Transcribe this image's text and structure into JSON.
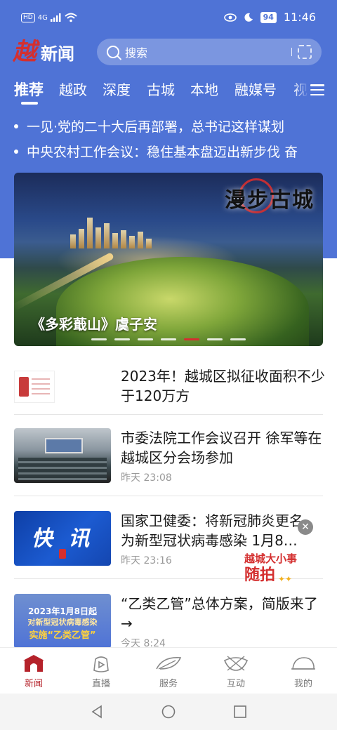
{
  "status_bar": {
    "left": [
      "HD",
      "4G"
    ],
    "battery": "94",
    "time": "11:46"
  },
  "header": {
    "logo": "越",
    "app_name": "新闻",
    "search_placeholder": "搜索"
  },
  "tabs": [
    {
      "label": "推荐",
      "active": true
    },
    {
      "label": "越政"
    },
    {
      "label": "深度"
    },
    {
      "label": "古城"
    },
    {
      "label": "本地"
    },
    {
      "label": "融媒号"
    },
    {
      "label": "视"
    }
  ],
  "ticker": [
    "一见·党的二十大后再部署，总书记这样谋划",
    "中央农村工作会议：稳住基本盘迈出新步伐 奋"
  ],
  "banner": {
    "brand_text": "漫步古城",
    "caption": "《多彩蕺山》虞子安",
    "slide_count": 7,
    "active_slide": 5
  },
  "news": [
    {
      "title": "2023年！越城区拟征收面积不少于120万方",
      "meta": ""
    },
    {
      "title": "市委法院工作会议召开  徐军等在越城区分会场参加",
      "meta": "昨天  23:08"
    },
    {
      "title": "国家卫健委：将新冠肺炎更名为新型冠状病毒感染 1月8…",
      "meta": "昨天  23:16",
      "thumb_text": "快 讯"
    },
    {
      "title": "“乙类乙管”总体方案，简版来了→",
      "meta": "今天  8:24",
      "thumb_lines": [
        "2023年1月8日起",
        "对新型冠状病毒感染",
        "实施“乙类乙管”"
      ]
    }
  ],
  "floating_widget": {
    "line1": "越城大小事",
    "line2": "随拍",
    "close": "✕"
  },
  "bottom_nav": [
    {
      "label": "新闻",
      "icon": "home-gate-icon",
      "active": true
    },
    {
      "label": "直播",
      "icon": "live-icon"
    },
    {
      "label": "服务",
      "icon": "leaf-service-icon"
    },
    {
      "label": "互动",
      "icon": "interact-icon"
    },
    {
      "label": "我的",
      "icon": "profile-hat-icon"
    }
  ],
  "colors": {
    "header_blue": "#4f73d6",
    "brand_red": "#d42f2f",
    "nav_active": "#b5222a"
  }
}
